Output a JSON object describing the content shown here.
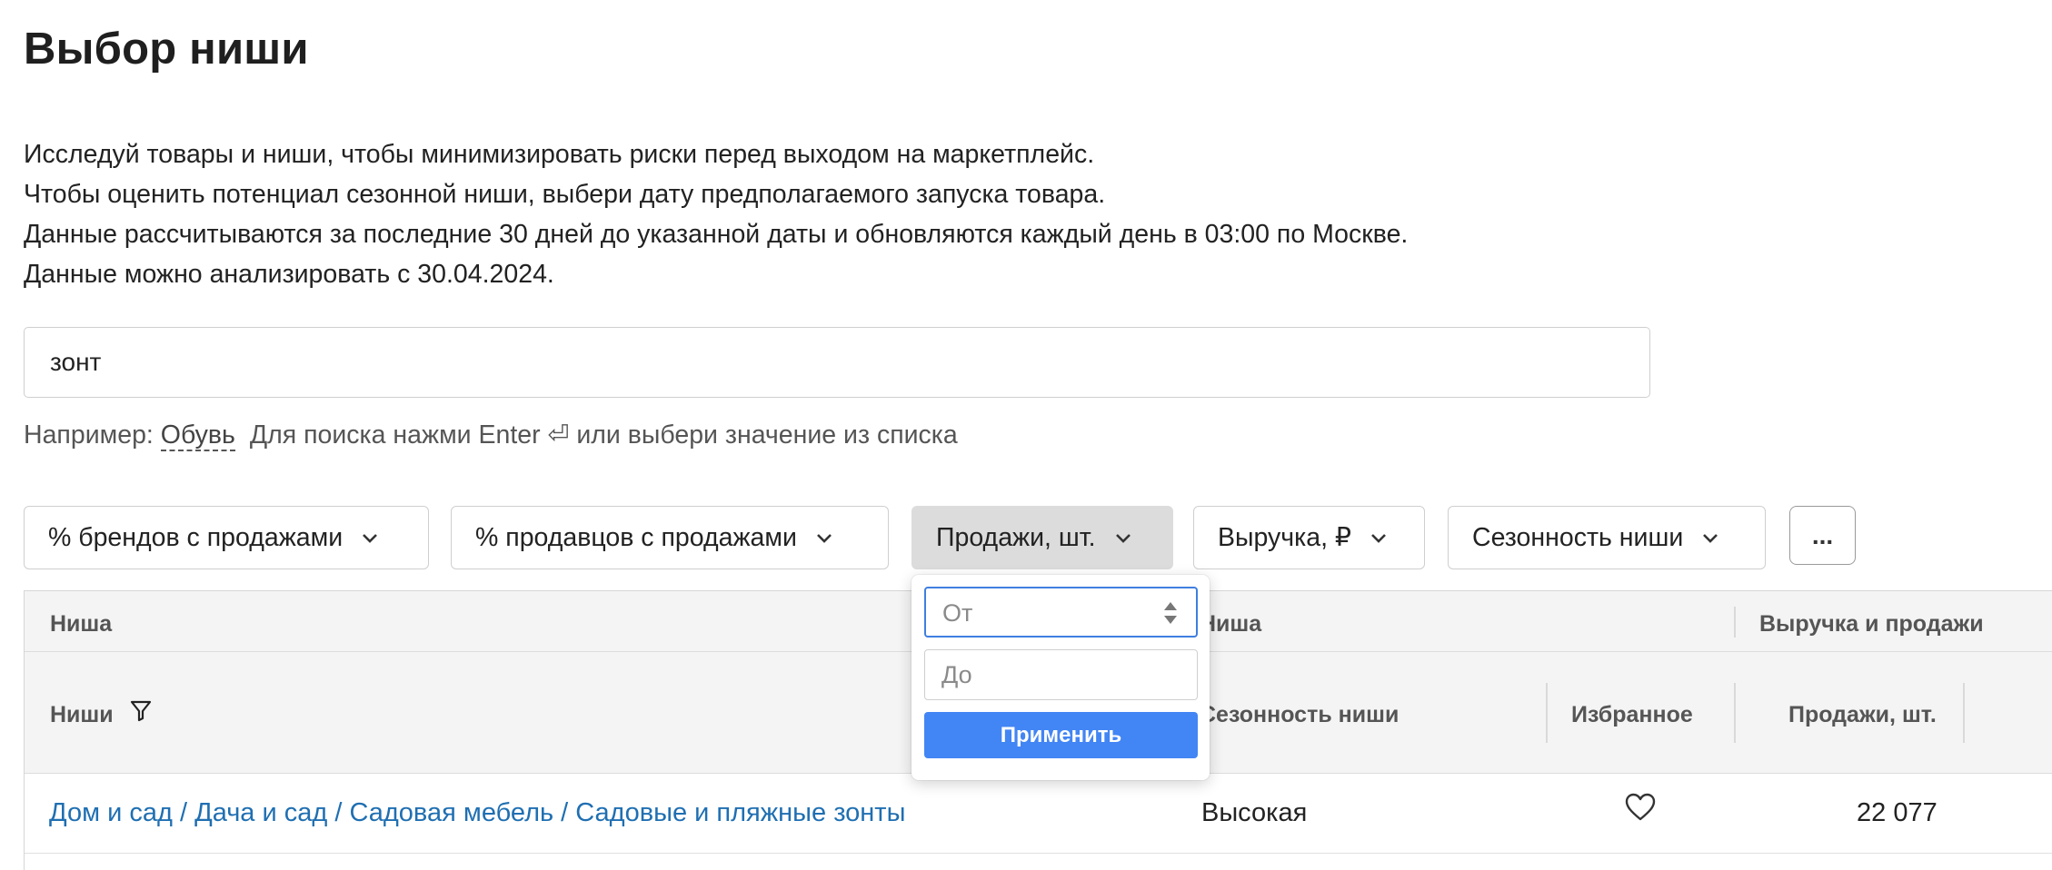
{
  "page": {
    "title": "Выбор ниши",
    "description": [
      "Исследуй товары и ниши, чтобы минимизировать риски перед выходом на маркетплейс.",
      "Чтобы оценить потенциал сезонной ниши, выбери дату предполагаемого запуска товара.",
      "Данные рассчитываются за последние 30 дней до указанной даты и обновляются каждый день в 03:00 по Москве.",
      "Данные можно анализировать с 30.04.2024."
    ]
  },
  "search": {
    "value": "зонт",
    "hint_prefix": "Например:",
    "hint_example": "Обувь",
    "hint_suffix": "Для поиска нажми Enter ⏎ или выбери значение из списка"
  },
  "filters": [
    {
      "label": "% брендов с продажами",
      "active": false
    },
    {
      "label": "% продавцов с продажами",
      "active": false
    },
    {
      "label": "Продажи, шт.",
      "active": true
    },
    {
      "label": "Выручка, ₽",
      "active": false
    },
    {
      "label": "Сезонность ниши",
      "active": false
    }
  ],
  "more_button": "...",
  "range_popover": {
    "from_placeholder": "От",
    "to_placeholder": "До",
    "apply_label": "Применить"
  },
  "table": {
    "group_headers": [
      "Ниша",
      "Ниша",
      "Выручка и продажи"
    ],
    "columns": [
      "Ниши",
      "Сезонность ниши",
      "Избранное",
      "Продажи, шт."
    ],
    "rows": [
      {
        "niche": "Дом и сад / Дача и сад / Садовая мебель / Садовые и пляжные зонты",
        "seasonality": "Высокая",
        "favorite": false,
        "sales": "22 077"
      }
    ]
  },
  "colors": {
    "accent": "#4285f4",
    "link": "#1f6fb2",
    "header_bg": "#f4f4f4"
  },
  "icons": {
    "filter": "filter-icon",
    "favorite": "heart-outline-icon",
    "dropdown": "chevron-down-icon",
    "spinner": "number-spinner-icon"
  }
}
